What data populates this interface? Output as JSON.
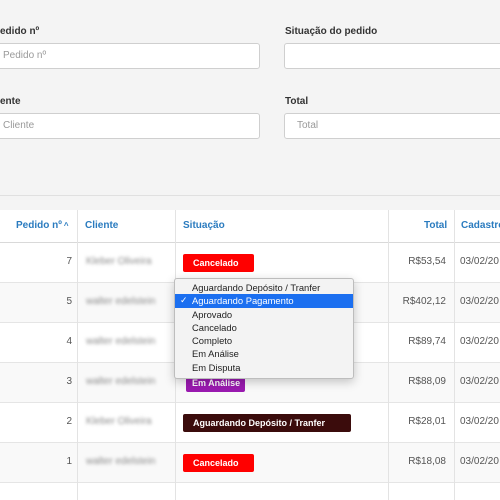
{
  "filters": {
    "pedido_label": "edido nº",
    "pedido_placeholder": "Pedido nº",
    "situacao_label": "Situação do pedido",
    "cliente_label": "ente",
    "cliente_placeholder": "Cliente",
    "total_label": "Total",
    "total_placeholder": "Total"
  },
  "table": {
    "headers": {
      "pedido": "Pedido nº",
      "sort_icon": "^",
      "cliente": "Cliente",
      "situacao": "Situação",
      "total": "Total",
      "cadastro": "Cadastro"
    },
    "rows": [
      {
        "pedido": "7",
        "cliente": "Kleber Oliveira",
        "situacao": "Cancelado",
        "total": "R$53,54",
        "cadastro": "03/02/20"
      },
      {
        "pedido": "5",
        "cliente": "walter edelstein",
        "situacao": "",
        "total": "R$402,12",
        "cadastro": "03/02/20"
      },
      {
        "pedido": "4",
        "cliente": "walter edelstein",
        "situacao": "",
        "total": "R$89,74",
        "cadastro": "03/02/20"
      },
      {
        "pedido": "3",
        "cliente": "walter edelstein",
        "situacao": "Em Análise",
        "total": "R$88,09",
        "cadastro": "03/02/20"
      },
      {
        "pedido": "2",
        "cliente": "Kleber Oliveira",
        "situacao": "Aguardando Depósito / Tranfer",
        "total": "R$28,01",
        "cadastro": "03/02/20"
      },
      {
        "pedido": "1",
        "cliente": "walter edelstein",
        "situacao": "Cancelado",
        "total": "R$18,08",
        "cadastro": "03/02/20"
      }
    ]
  },
  "status_dropdown": {
    "options": [
      "Aguardando Depósito / Tranfer",
      "Aguardando Pagamento",
      "Aprovado",
      "Cancelado",
      "Completo",
      "Em Análise",
      "Em Disputa"
    ],
    "selected_index": 1,
    "check_mark": "✓"
  },
  "colors": {
    "cancelado": "#ff0000",
    "em_analise": "#9a1ab0",
    "aguardando_deposito": "#3b0c0c",
    "header_text": "#2a7bbf",
    "selection": "#1b6ff0"
  }
}
